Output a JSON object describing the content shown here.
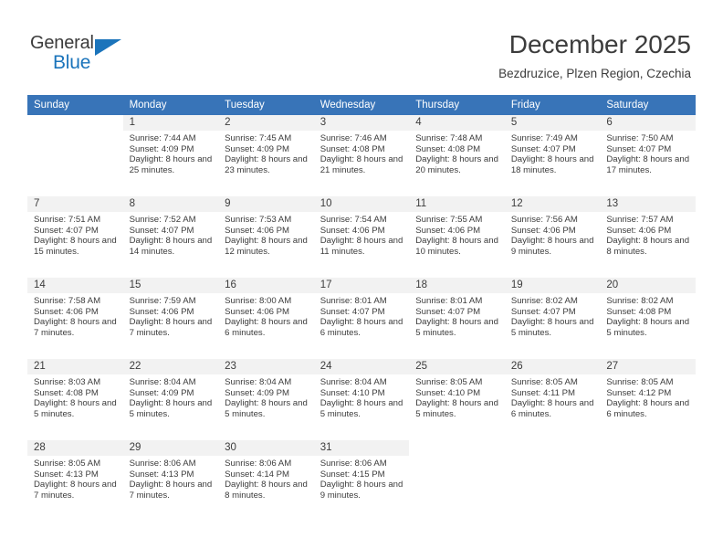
{
  "brand": {
    "name_part1": "General",
    "name_part2": "Blue",
    "accent_color": "#1b74bb"
  },
  "header": {
    "title": "December 2025",
    "subtitle": "Bezdruzice, Plzen Region, Czechia"
  },
  "calendar": {
    "header_color": "#3874b8",
    "weekday_headers": [
      "Sunday",
      "Monday",
      "Tuesday",
      "Wednesday",
      "Thursday",
      "Friday",
      "Saturday"
    ],
    "weeks": [
      [
        {
          "day": "",
          "blank": true,
          "sunrise": "",
          "sunset": "",
          "daylight": ""
        },
        {
          "day": "1",
          "sunrise": "Sunrise: 7:44 AM",
          "sunset": "Sunset: 4:09 PM",
          "daylight": "Daylight: 8 hours and 25 minutes."
        },
        {
          "day": "2",
          "sunrise": "Sunrise: 7:45 AM",
          "sunset": "Sunset: 4:09 PM",
          "daylight": "Daylight: 8 hours and 23 minutes."
        },
        {
          "day": "3",
          "sunrise": "Sunrise: 7:46 AM",
          "sunset": "Sunset: 4:08 PM",
          "daylight": "Daylight: 8 hours and 21 minutes."
        },
        {
          "day": "4",
          "sunrise": "Sunrise: 7:48 AM",
          "sunset": "Sunset: 4:08 PM",
          "daylight": "Daylight: 8 hours and 20 minutes."
        },
        {
          "day": "5",
          "sunrise": "Sunrise: 7:49 AM",
          "sunset": "Sunset: 4:07 PM",
          "daylight": "Daylight: 8 hours and 18 minutes."
        },
        {
          "day": "6",
          "sunrise": "Sunrise: 7:50 AM",
          "sunset": "Sunset: 4:07 PM",
          "daylight": "Daylight: 8 hours and 17 minutes."
        }
      ],
      [
        {
          "day": "7",
          "sunrise": "Sunrise: 7:51 AM",
          "sunset": "Sunset: 4:07 PM",
          "daylight": "Daylight: 8 hours and 15 minutes."
        },
        {
          "day": "8",
          "sunrise": "Sunrise: 7:52 AM",
          "sunset": "Sunset: 4:07 PM",
          "daylight": "Daylight: 8 hours and 14 minutes."
        },
        {
          "day": "9",
          "sunrise": "Sunrise: 7:53 AM",
          "sunset": "Sunset: 4:06 PM",
          "daylight": "Daylight: 8 hours and 12 minutes."
        },
        {
          "day": "10",
          "sunrise": "Sunrise: 7:54 AM",
          "sunset": "Sunset: 4:06 PM",
          "daylight": "Daylight: 8 hours and 11 minutes."
        },
        {
          "day": "11",
          "sunrise": "Sunrise: 7:55 AM",
          "sunset": "Sunset: 4:06 PM",
          "daylight": "Daylight: 8 hours and 10 minutes."
        },
        {
          "day": "12",
          "sunrise": "Sunrise: 7:56 AM",
          "sunset": "Sunset: 4:06 PM",
          "daylight": "Daylight: 8 hours and 9 minutes."
        },
        {
          "day": "13",
          "sunrise": "Sunrise: 7:57 AM",
          "sunset": "Sunset: 4:06 PM",
          "daylight": "Daylight: 8 hours and 8 minutes."
        }
      ],
      [
        {
          "day": "14",
          "sunrise": "Sunrise: 7:58 AM",
          "sunset": "Sunset: 4:06 PM",
          "daylight": "Daylight: 8 hours and 7 minutes."
        },
        {
          "day": "15",
          "sunrise": "Sunrise: 7:59 AM",
          "sunset": "Sunset: 4:06 PM",
          "daylight": "Daylight: 8 hours and 7 minutes."
        },
        {
          "day": "16",
          "sunrise": "Sunrise: 8:00 AM",
          "sunset": "Sunset: 4:06 PM",
          "daylight": "Daylight: 8 hours and 6 minutes."
        },
        {
          "day": "17",
          "sunrise": "Sunrise: 8:01 AM",
          "sunset": "Sunset: 4:07 PM",
          "daylight": "Daylight: 8 hours and 6 minutes."
        },
        {
          "day": "18",
          "sunrise": "Sunrise: 8:01 AM",
          "sunset": "Sunset: 4:07 PM",
          "daylight": "Daylight: 8 hours and 5 minutes."
        },
        {
          "day": "19",
          "sunrise": "Sunrise: 8:02 AM",
          "sunset": "Sunset: 4:07 PM",
          "daylight": "Daylight: 8 hours and 5 minutes."
        },
        {
          "day": "20",
          "sunrise": "Sunrise: 8:02 AM",
          "sunset": "Sunset: 4:08 PM",
          "daylight": "Daylight: 8 hours and 5 minutes."
        }
      ],
      [
        {
          "day": "21",
          "sunrise": "Sunrise: 8:03 AM",
          "sunset": "Sunset: 4:08 PM",
          "daylight": "Daylight: 8 hours and 5 minutes."
        },
        {
          "day": "22",
          "sunrise": "Sunrise: 8:04 AM",
          "sunset": "Sunset: 4:09 PM",
          "daylight": "Daylight: 8 hours and 5 minutes."
        },
        {
          "day": "23",
          "sunrise": "Sunrise: 8:04 AM",
          "sunset": "Sunset: 4:09 PM",
          "daylight": "Daylight: 8 hours and 5 minutes."
        },
        {
          "day": "24",
          "sunrise": "Sunrise: 8:04 AM",
          "sunset": "Sunset: 4:10 PM",
          "daylight": "Daylight: 8 hours and 5 minutes."
        },
        {
          "day": "25",
          "sunrise": "Sunrise: 8:05 AM",
          "sunset": "Sunset: 4:10 PM",
          "daylight": "Daylight: 8 hours and 5 minutes."
        },
        {
          "day": "26",
          "sunrise": "Sunrise: 8:05 AM",
          "sunset": "Sunset: 4:11 PM",
          "daylight": "Daylight: 8 hours and 6 minutes."
        },
        {
          "day": "27",
          "sunrise": "Sunrise: 8:05 AM",
          "sunset": "Sunset: 4:12 PM",
          "daylight": "Daylight: 8 hours and 6 minutes."
        }
      ],
      [
        {
          "day": "28",
          "sunrise": "Sunrise: 8:05 AM",
          "sunset": "Sunset: 4:13 PM",
          "daylight": "Daylight: 8 hours and 7 minutes."
        },
        {
          "day": "29",
          "sunrise": "Sunrise: 8:06 AM",
          "sunset": "Sunset: 4:13 PM",
          "daylight": "Daylight: 8 hours and 7 minutes."
        },
        {
          "day": "30",
          "sunrise": "Sunrise: 8:06 AM",
          "sunset": "Sunset: 4:14 PM",
          "daylight": "Daylight: 8 hours and 8 minutes."
        },
        {
          "day": "31",
          "sunrise": "Sunrise: 8:06 AM",
          "sunset": "Sunset: 4:15 PM",
          "daylight": "Daylight: 8 hours and 9 minutes."
        },
        {
          "day": "",
          "blank": true,
          "sunrise": "",
          "sunset": "",
          "daylight": ""
        },
        {
          "day": "",
          "blank": true,
          "sunrise": "",
          "sunset": "",
          "daylight": ""
        },
        {
          "day": "",
          "blank": true,
          "sunrise": "",
          "sunset": "",
          "daylight": ""
        }
      ]
    ]
  }
}
